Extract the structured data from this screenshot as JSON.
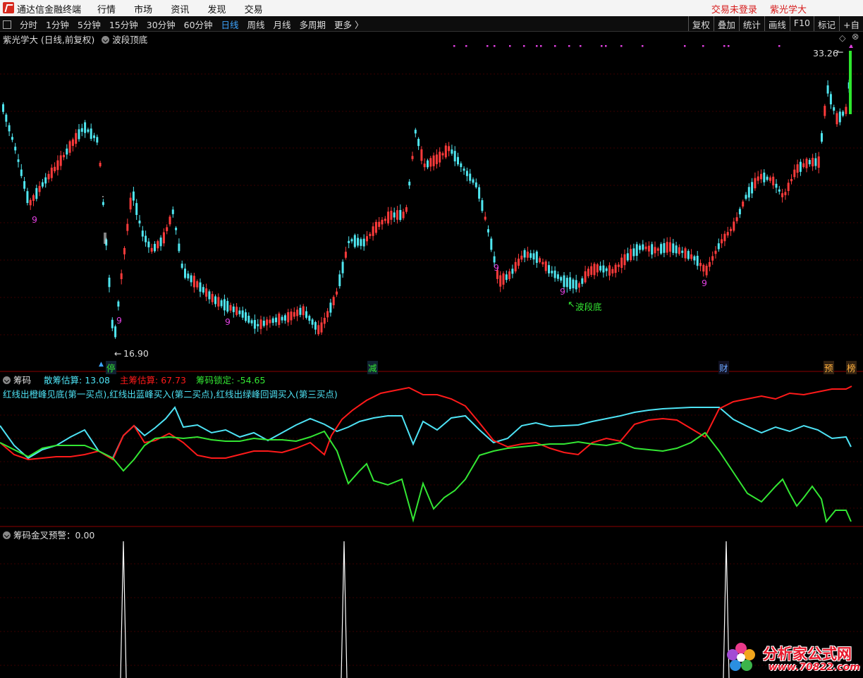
{
  "titlebar": {
    "app_name": "通达信金融终端",
    "menu": [
      "行情",
      "市场",
      "资讯",
      "发现",
      "交易"
    ],
    "trade_status": "交易未登录",
    "user": "紫光学大"
  },
  "toolbar": {
    "periods": [
      "分时",
      "1分钟",
      "5分钟",
      "15分钟",
      "30分钟",
      "60分钟",
      "日线",
      "周线",
      "月线",
      "多周期",
      "更多 〉"
    ],
    "active": "日线",
    "right_buttons": [
      "复权",
      "叠加",
      "统计",
      "画线",
      "F10",
      "标记",
      "+自"
    ]
  },
  "main_panel": {
    "stock_title": "紫光学大 (日线,前复权)",
    "indicator": "波段顶底",
    "high_label": "33.26",
    "low_label": "16.90",
    "bottom_label": "波段底",
    "nine_marker": "9",
    "event_markers": [
      "停",
      "减",
      "财",
      "预",
      "榜"
    ],
    "colors": {
      "up": "#ff3b3b",
      "down": "#4fe6f0",
      "magenta": "#e040e0"
    }
  },
  "chip_panel": {
    "name": "筹码",
    "retail_label": "散筹估算:",
    "retail_value": "13.08",
    "main_label": "主筹估算:",
    "main_value": "67.73",
    "lock_label": "筹码锁定:",
    "lock_value": "-54.65",
    "description": "红线出橙峰见底(第一买点),红线出蓝峰买入(第二买点),红线出绿峰回调买入(第三买点)",
    "colors": {
      "retail": "#4ee3f5",
      "main": "#ff1a1a",
      "lock": "#33e633"
    }
  },
  "alert_panel": {
    "name": "筹码金叉预警",
    "value": "0.00"
  },
  "watermark": {
    "text": "分析家公式网",
    "url": "www.70822.com"
  }
}
